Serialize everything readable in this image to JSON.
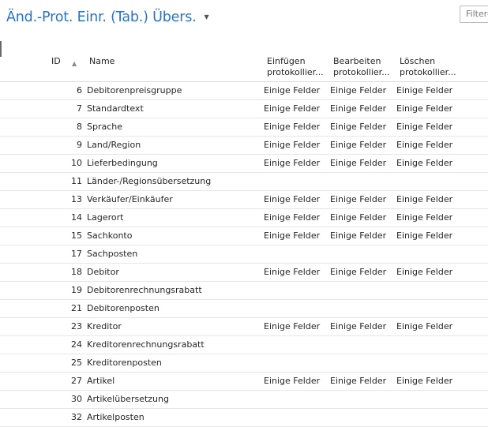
{
  "header": {
    "title": "Änd.-Prot. Einr. (Tab.) Übers.",
    "filter_placeholder": "Filtere"
  },
  "columns": {
    "id": "ID",
    "name": "Name",
    "insert_line1": "Einfügen",
    "insert_line2": "protokollier...",
    "modify_line1": "Bearbeiten",
    "modify_line2": "protokollier...",
    "delete_line1": "Löschen",
    "delete_line2": "protokollier..."
  },
  "rows": [
    {
      "id": "6",
      "name": "Debitorenpreisgruppe",
      "insert": "Einige Felder",
      "modify": "Einige Felder",
      "delete": "Einige Felder"
    },
    {
      "id": "7",
      "name": "Standardtext",
      "insert": "Einige Felder",
      "modify": "Einige Felder",
      "delete": "Einige Felder"
    },
    {
      "id": "8",
      "name": "Sprache",
      "insert": "Einige Felder",
      "modify": "Einige Felder",
      "delete": "Einige Felder"
    },
    {
      "id": "9",
      "name": "Land/Region",
      "insert": "Einige Felder",
      "modify": "Einige Felder",
      "delete": "Einige Felder"
    },
    {
      "id": "10",
      "name": "Lieferbedingung",
      "insert": "Einige Felder",
      "modify": "Einige Felder",
      "delete": "Einige Felder"
    },
    {
      "id": "11",
      "name": "Länder-/Regionsübersetzung",
      "insert": "",
      "modify": "",
      "delete": ""
    },
    {
      "id": "13",
      "name": "Verkäufer/Einkäufer",
      "insert": "Einige Felder",
      "modify": "Einige Felder",
      "delete": "Einige Felder"
    },
    {
      "id": "14",
      "name": "Lagerort",
      "insert": "Einige Felder",
      "modify": "Einige Felder",
      "delete": "Einige Felder"
    },
    {
      "id": "15",
      "name": "Sachkonto",
      "insert": "Einige Felder",
      "modify": "Einige Felder",
      "delete": "Einige Felder"
    },
    {
      "id": "17",
      "name": "Sachposten",
      "insert": "",
      "modify": "",
      "delete": ""
    },
    {
      "id": "18",
      "name": "Debitor",
      "insert": "Einige Felder",
      "modify": "Einige Felder",
      "delete": "Einige Felder"
    },
    {
      "id": "19",
      "name": "Debitorenrechnungsrabatt",
      "insert": "",
      "modify": "",
      "delete": ""
    },
    {
      "id": "21",
      "name": "Debitorenposten",
      "insert": "",
      "modify": "",
      "delete": ""
    },
    {
      "id": "23",
      "name": "Kreditor",
      "insert": "Einige Felder",
      "modify": "Einige Felder",
      "delete": "Einige Felder"
    },
    {
      "id": "24",
      "name": "Kreditorenrechnungsrabatt",
      "insert": "",
      "modify": "",
      "delete": ""
    },
    {
      "id": "25",
      "name": "Kreditorenposten",
      "insert": "",
      "modify": "",
      "delete": ""
    },
    {
      "id": "27",
      "name": "Artikel",
      "insert": "Einige Felder",
      "modify": "Einige Felder",
      "delete": "Einige Felder"
    },
    {
      "id": "30",
      "name": "Artikelübersetzung",
      "insert": "",
      "modify": "",
      "delete": ""
    },
    {
      "id": "32",
      "name": "Artikelposten",
      "insert": "",
      "modify": "",
      "delete": ""
    }
  ]
}
